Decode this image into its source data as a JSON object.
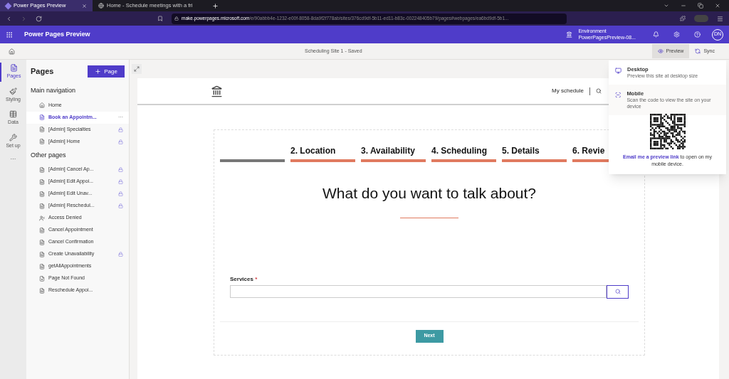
{
  "browser": {
    "tabs": [
      {
        "title": "Power Pages Preview",
        "selected": true
      },
      {
        "title": "Home - Schedule meetings with a fri",
        "selected": false
      }
    ],
    "url_host": "make.powerpages.microsoft.com",
    "url_path": "/e/90abbb4e-1232-e00f-8058-8da9f2f778ab/sites/376cd9df-5b11-ed11-b83c-002248405b79/pages#webpages/ea6bd9df-5b1..."
  },
  "app": {
    "title": "Power Pages Preview",
    "environment_label": "Environment",
    "environment": "PowerPagesPreview-08...",
    "avatar": "DN"
  },
  "command_bar": {
    "status": "Scheduling Site 1 - Saved",
    "buttons": [
      {
        "label": "Preview",
        "kind": "preview",
        "selected": true
      },
      {
        "label": "Sync",
        "kind": "sync",
        "selected": false
      }
    ]
  },
  "rail": {
    "items": [
      {
        "label": "Pages",
        "kind": "pages",
        "selected": true
      },
      {
        "label": "Styling",
        "kind": "styling",
        "selected": false
      },
      {
        "label": "Data",
        "kind": "data",
        "selected": false
      },
      {
        "label": "Set up",
        "kind": "setup",
        "selected": false
      }
    ],
    "more": "···"
  },
  "pages_panel": {
    "title": "Pages",
    "add_button": "Page",
    "sections": [
      {
        "title": "Main navigation",
        "items": [
          {
            "label": "Home",
            "kind": "home",
            "locked": false,
            "selected": false
          },
          {
            "label": "Book an Appointm...",
            "kind": "page",
            "locked": false,
            "selected": true,
            "more": "···"
          },
          {
            "label": "[Admin] Specialties",
            "kind": "page",
            "locked": true,
            "selected": false
          },
          {
            "label": "[Admin] Home",
            "kind": "page",
            "locked": true,
            "selected": false
          }
        ]
      },
      {
        "title": "Other pages",
        "items": [
          {
            "label": "[Admin] Cancel Ap...",
            "kind": "page",
            "locked": true,
            "selected": false
          },
          {
            "label": "[Admin] Edit Appoi...",
            "kind": "page",
            "locked": true,
            "selected": false
          },
          {
            "label": "[Admin] Edit Unav...",
            "kind": "page",
            "locked": true,
            "selected": false
          },
          {
            "label": "[Admin] Reschedul...",
            "kind": "page",
            "locked": true,
            "selected": false
          },
          {
            "label": "Access Denied",
            "kind": "user",
            "locked": false,
            "selected": false
          },
          {
            "label": "Cancel Appointment",
            "kind": "page",
            "locked": false,
            "selected": false
          },
          {
            "label": "Cancel Confirmation",
            "kind": "page",
            "locked": false,
            "selected": false
          },
          {
            "label": "Create Unavailability",
            "kind": "page",
            "locked": true,
            "selected": false
          },
          {
            "label": "getAllAppointments",
            "kind": "page",
            "locked": false,
            "selected": false
          },
          {
            "label": "Page Not Found",
            "kind": "missing",
            "locked": false,
            "selected": false
          },
          {
            "label": "Reschedule Appoi...",
            "kind": "page",
            "locked": false,
            "selected": false
          }
        ]
      }
    ]
  },
  "site": {
    "nav": "My schedule",
    "steps": [
      {
        "selected": true
      },
      {
        "label": "2. Location",
        "selected": false
      },
      {
        "label": "3. Availability",
        "selected": false
      },
      {
        "label": "4. Scheduling",
        "selected": false
      },
      {
        "label": "5. Details",
        "selected": false
      },
      {
        "label": "6. Revie",
        "selected": false
      }
    ],
    "heading": "What do you want to talk about?",
    "field": {
      "label": "Services",
      "required_mark": "*"
    },
    "next": "Next"
  },
  "preview_menu": {
    "options": [
      {
        "title": "Desktop",
        "description": "Preview this site at desktop size",
        "kind": "desktop"
      },
      {
        "title": "Mobile",
        "description": "Scan the code to view the site on your device",
        "kind": "mobile"
      }
    ],
    "link": "Email me a preview link",
    "link_suffix": "to open on my mobile device."
  }
}
